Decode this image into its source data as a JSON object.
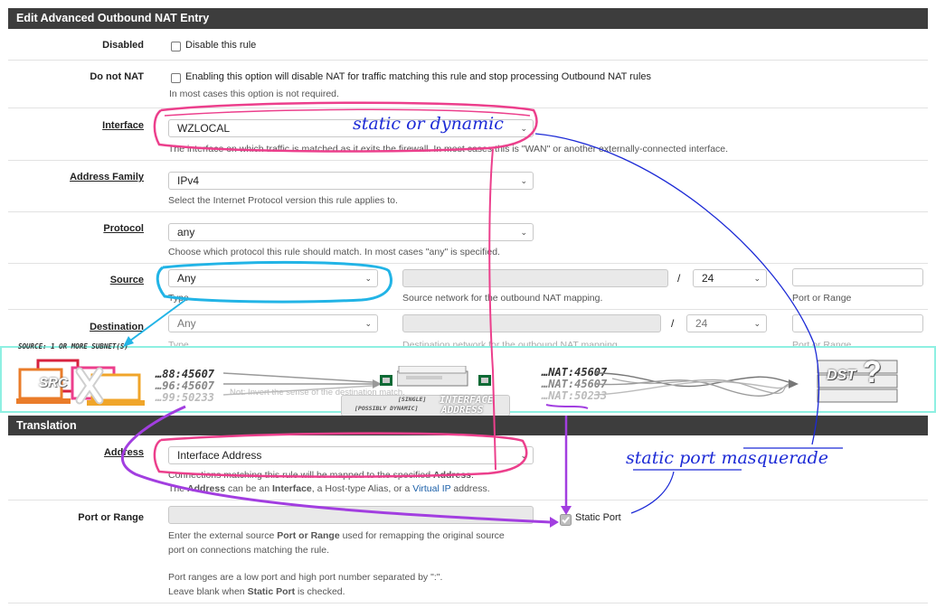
{
  "header": {
    "title": "Edit Advanced Outbound NAT Entry"
  },
  "disabled": {
    "label": "Disabled",
    "checkbox_label": "Disable this rule"
  },
  "donotnat": {
    "label": "Do not NAT",
    "checkbox_label": "Enabling this option will disable NAT for traffic matching this rule and stop processing Outbound NAT rules",
    "help": "In most cases this option is not required."
  },
  "interface": {
    "label": "Interface",
    "value": "WZLOCAL",
    "help": "The interface on which traffic is matched as it exits the firewall. In most cases this is \"WAN\" or another externally-connected interface."
  },
  "address_family": {
    "label": "Address Family",
    "value": "IPv4",
    "help": "Select the Internet Protocol version this rule applies to."
  },
  "protocol": {
    "label": "Protocol",
    "value": "any",
    "help": "Choose which protocol this rule should match. In most cases \"any\" is specified."
  },
  "source": {
    "label": "Source",
    "value": "Any",
    "type_help": "Type",
    "network_help": "Source network for the outbound NAT mapping.",
    "slash": "/",
    "mask": "24",
    "port_help": "Port or Range"
  },
  "destination": {
    "label": "Destination",
    "value": "Any",
    "type_help": "Type",
    "network_help": "Destination network for the outbound NAT mapping.",
    "slash": "/",
    "mask": "24",
    "port_help": "Port or Range",
    "extra_help": "Not: Invert the sense of the destination match."
  },
  "diagram": {
    "src_note": "SOURCE: 1 OR MORE SUBNET(S)",
    "src_label": "SRC",
    "src_ports": [
      "…88:45607",
      "…96:45607",
      "…99:50233"
    ],
    "nat_ports": [
      "…NAT:45607",
      "…NAT:45607",
      "…NAT:50233"
    ],
    "iface_small1": "[SINGLE]",
    "iface_big1": "INTERFACE",
    "iface_small2": "[POSSIBLY DYNAMIC]",
    "iface_big2": "ADDRESS",
    "dst_label": "DST"
  },
  "translation": {
    "title": "Translation"
  },
  "address": {
    "label": "Address",
    "value": "Interface Address",
    "help1_a": "Connections matching this rule will be mapped to the specified ",
    "help1_b": "Address",
    "help2_a": "The ",
    "help2_b": "Address",
    "help2_c": " can be an ",
    "help2_d": "Interface",
    "help2_e": ", a Host-type Alias, or a ",
    "help2_link": "Virtual IP",
    "help2_f": " address."
  },
  "port_range": {
    "label": "Port or Range",
    "static_port_label": "Static Port",
    "static_port_checked": true,
    "help1_a": "Enter the external source ",
    "help1_b": "Port or Range",
    "help1_c": " used for remapping the original source",
    "help2": "port on connections matching the rule.",
    "help3": "Port ranges are a low port and high port number separated by \":\".",
    "help4_a": "Leave blank when ",
    "help4_b": "Static Port",
    "help4_c": " is checked."
  },
  "annotations": {
    "static_or_dynamic": "static or dynamic",
    "static_port_masquerade": "static port masquerade"
  },
  "colors": {
    "header_bg": "#3d3d3d",
    "pink": "#ec3f8c",
    "cyan": "#22b4e6",
    "purple": "#a23ee0",
    "blue_ink": "#1c2ad6",
    "strip_border": "#8ef0e2"
  }
}
